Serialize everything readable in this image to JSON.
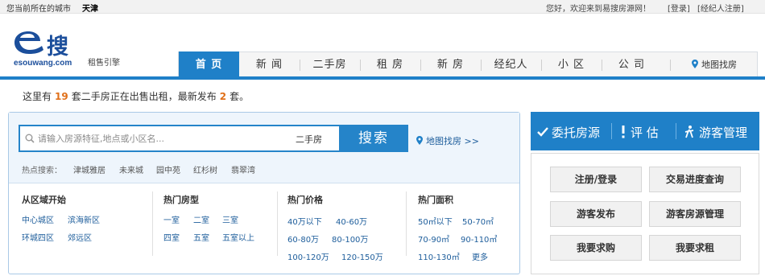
{
  "topbar": {
    "city_prefix": "您当前所在的城市",
    "city_name": "天津",
    "welcome": "您好，欢迎来到易搜房源网！",
    "login": "[登录]",
    "agent_register": "[经纪人注册]"
  },
  "header": {
    "logo_text": "搜",
    "logo_domain": "esouwang.com",
    "logo_sub": "租售引擎"
  },
  "nav": {
    "items": [
      "首 页",
      "新 闻",
      "二手房",
      "租 房",
      "新 房",
      "经纪人",
      "小 区",
      "公 司"
    ],
    "active_index": 0,
    "map_search": "地图找房"
  },
  "stats": {
    "prefix": "这里有",
    "count": "19",
    "middle": "套二手房正在出售出租，最新发布",
    "new_count": "2",
    "suffix": "套。"
  },
  "search": {
    "placeholder": "请输入房源特征,地点或小区名...",
    "scope": "二手房",
    "button": "搜索",
    "map_search": "地图找房 >>",
    "hot_label": "热点搜索：",
    "hot_keywords": [
      "津城雅居",
      "未来城",
      "园中苑",
      "红杉树",
      "翡翠湾"
    ]
  },
  "filters": {
    "area": {
      "title": "从区域开始",
      "links": [
        "中心城区",
        "滨海新区",
        "环城四区",
        "郊远区"
      ]
    },
    "layout": {
      "title": "热门房型",
      "links": [
        "一室",
        "二室",
        "三室",
        "四室",
        "五室",
        "五室以上"
      ]
    },
    "price": {
      "title": "热门价格",
      "links": [
        "40万以下",
        "40-60万",
        "60-80万",
        "80-100万",
        "100-120万",
        "120-150万"
      ]
    },
    "size": {
      "title": "热门面积",
      "links": [
        "50㎡以下",
        "50-70㎡",
        "70-90㎡",
        "90-110㎡",
        "110-130㎡",
        "更多"
      ]
    }
  },
  "right_panel": {
    "top": [
      "委托房源",
      "评 估",
      "游客管理"
    ],
    "buttons": [
      "注册/登录",
      "交易进度查询",
      "游客发布",
      "游客房源管理",
      "我要求购",
      "我要求租"
    ]
  },
  "colors": {
    "brand_blue": "#1f80c8",
    "number_orange": "#e0701a",
    "link_blue": "#1d5d9b"
  }
}
